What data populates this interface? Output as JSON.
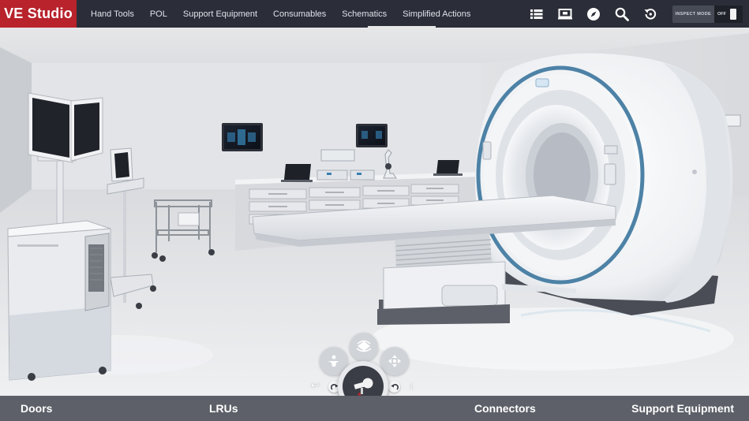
{
  "app": {
    "brand": "VE Studio"
  },
  "nav": {
    "items": [
      {
        "label": "Hand Tools"
      },
      {
        "label": "POL"
      },
      {
        "label": "Support Equipment"
      },
      {
        "label": "Consumables"
      },
      {
        "label": "Schematics"
      },
      {
        "label": "Simplified Actions"
      }
    ],
    "active_index": 5
  },
  "toolbar": {
    "icons": [
      "list-icon",
      "screen-icon",
      "compass-icon",
      "search-icon",
      "reset-view-icon"
    ],
    "inspect_mode_label": "INSPECT MODE",
    "inspect_mode_state": "OFF"
  },
  "bottom_bar": {
    "categories": [
      {
        "label": "Doors"
      },
      {
        "label": "LRUs"
      },
      {
        "label": "Connectors"
      },
      {
        "label": "Support Equipment"
      }
    ]
  },
  "nav_dial": {
    "left_arrow": "↩",
    "down_arrow": "↓",
    "icons": [
      "orbit-icon",
      "top-view-icon",
      "move-icon",
      "rotate-left-icon",
      "rotate-right-icon",
      "person-view-icon"
    ]
  },
  "colors": {
    "brand": "#b8232c",
    "topbar": "#2b2e38",
    "bottombar": "#5d6068",
    "mri_ring_accent": "#4d82a6"
  }
}
